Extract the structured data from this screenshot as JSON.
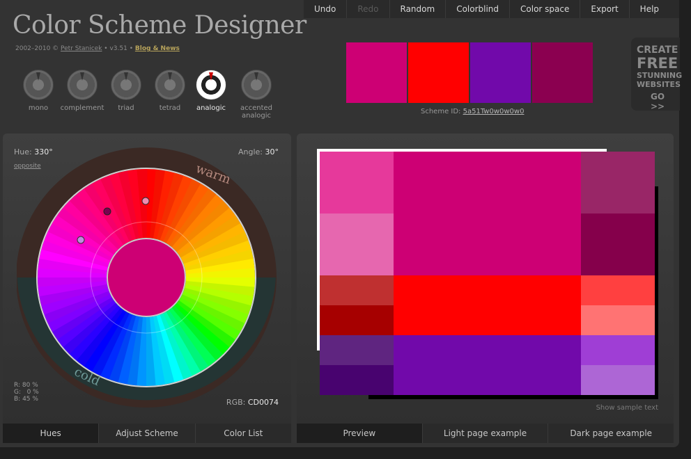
{
  "header": {
    "title": "Color Scheme Designer",
    "subtitle_pre": "2002–2010 © ",
    "author": "Petr Stanicek",
    "version": " • v3.51 • ",
    "blog": "Blog & News"
  },
  "scheme_types": [
    {
      "label": "mono",
      "active": false
    },
    {
      "label": "complement",
      "active": false
    },
    {
      "label": "triad",
      "active": false
    },
    {
      "label": "tetrad",
      "active": false
    },
    {
      "label": "analogic",
      "active": true
    },
    {
      "label": "accented analogic",
      "active": false
    }
  ],
  "menu": [
    {
      "label": "Undo",
      "enabled": true
    },
    {
      "label": "Redo",
      "enabled": false
    },
    {
      "label": "Random",
      "enabled": true
    },
    {
      "label": "Colorblind",
      "enabled": true
    },
    {
      "label": "Color space",
      "enabled": true
    },
    {
      "label": "Export",
      "enabled": true
    },
    {
      "label": "Help",
      "enabled": true
    }
  ],
  "swatches": [
    "#CD0074",
    "#FF0000",
    "#7109AA",
    "#8B0050"
  ],
  "scheme_id": {
    "label": "Scheme ID: ",
    "value": "5a51Tw0w0w0w0"
  },
  "ad": {
    "line1": "CREATE",
    "line2": "FREE",
    "line3": "STUNNING",
    "line4": "WEBSITES",
    "line5": "GO >>"
  },
  "wheel": {
    "hue_label": "Hue:",
    "hue_value": "330°",
    "opposite": "opposite",
    "angle_label": "Angle:",
    "angle_value": "30°",
    "warm": "warm",
    "cold": "cold",
    "center_color": "#CD0074",
    "rgb_pct": "R: 80 %\nG:   0 %\nB: 45 %",
    "rgb_label": "RGB:",
    "rgb_value": "CD0074"
  },
  "left_tabs": [
    {
      "label": "Hues",
      "active": true
    },
    {
      "label": "Adjust Scheme",
      "active": false
    },
    {
      "label": "Color List",
      "active": false
    }
  ],
  "right_tabs": [
    {
      "label": "Preview",
      "active": true
    },
    {
      "label": "Light page example",
      "active": false
    },
    {
      "label": "Dark page example",
      "active": false
    }
  ],
  "preview": {
    "sample_text": "Show sample text",
    "colors": {
      "p_main": "#CD0074",
      "p_light1": "#E6399B",
      "p_light2": "#E667AF",
      "p_dark1": "#992667",
      "p_dark2": "#85004B",
      "s1_main": "#FF0000",
      "s1_a": "#BF3030",
      "s1_b": "#A60000",
      "s1_c": "#FF4040",
      "s1_d": "#FF7373",
      "s2_main": "#7109AA",
      "s2_a": "#5F2580",
      "s2_b": "#48036F",
      "s2_c": "#9F3ED5",
      "s2_d": "#AD66D5"
    }
  }
}
